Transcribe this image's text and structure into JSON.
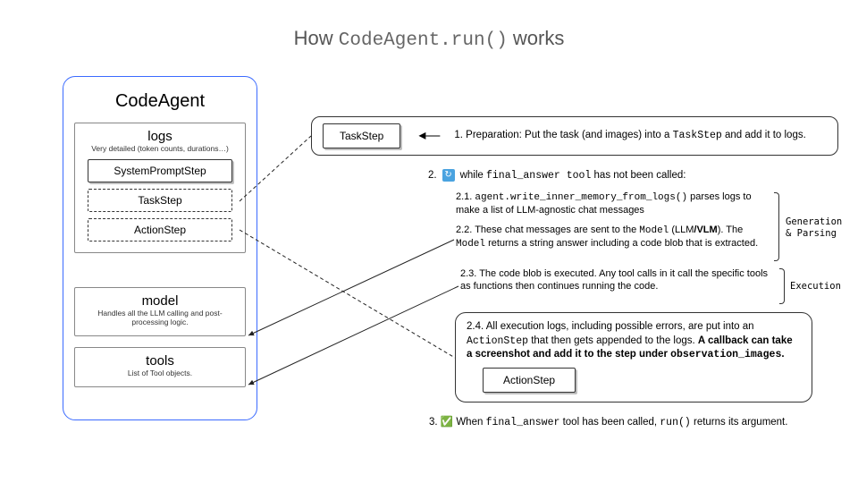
{
  "title_prefix": "How ",
  "title_code": "CodeAgent.run()",
  "title_suffix": " works",
  "agent": {
    "name": "CodeAgent",
    "logs": {
      "label": "logs",
      "sub": "Very detailed (token counts, durations…)",
      "steps": [
        "SystemPromptStep",
        "TaskStep",
        "ActionStep"
      ]
    },
    "model": {
      "label": "model",
      "sub": "Handles all the LLM calling and post-processing logic."
    },
    "tools": {
      "label": "tools",
      "sub": "List of Tool objects."
    }
  },
  "steps": {
    "s1": {
      "chip": "TaskStep",
      "num": "1.",
      "text_a": "  Preparation: Put the task (and images) into a ",
      "code": "TaskStep",
      "text_b": " and add it to logs."
    },
    "s2": {
      "num": "2.",
      "pre": "while  ",
      "code": "final_answer",
      "mid": " tool",
      "post": "  has not been called:",
      "s21": {
        "num": "2.1. ",
        "code": "agent.write_inner_memory_from_logs()",
        "text": " parses logs to make a list of LLM-agnostic chat messages"
      },
      "s22": {
        "pre": "2.2. These chat messages are sent to the ",
        "m1": "Model",
        "mid1": " (LLM",
        "bold": "/VLM",
        "mid2": "). The ",
        "m2": "Model",
        "post": "  returns a string answer including a code blob that is extracted."
      },
      "s23": "2.3. The code blob is executed. Any tool calls in it call the specific tools as functions then continues running the code.",
      "s24": {
        "pre": "2.4. All execution logs, including possible errors, are put into an ",
        "code1": "ActionStep",
        "mid": " that then gets appended to the logs. ",
        "bold": "A callback can  take a screenshot and add it to the step under ",
        "code2": "observation_images",
        "bold2": ".",
        "chip": "ActionStep"
      }
    },
    "s3": {
      "num": "3. ",
      "pre": "When ",
      "code1": "final_answer",
      "mid": " tool has been called, ",
      "code2": "run()",
      "post": " returns its argument."
    },
    "labels": {
      "gen": "Generation\n& Parsing",
      "exec": "Execution"
    }
  }
}
